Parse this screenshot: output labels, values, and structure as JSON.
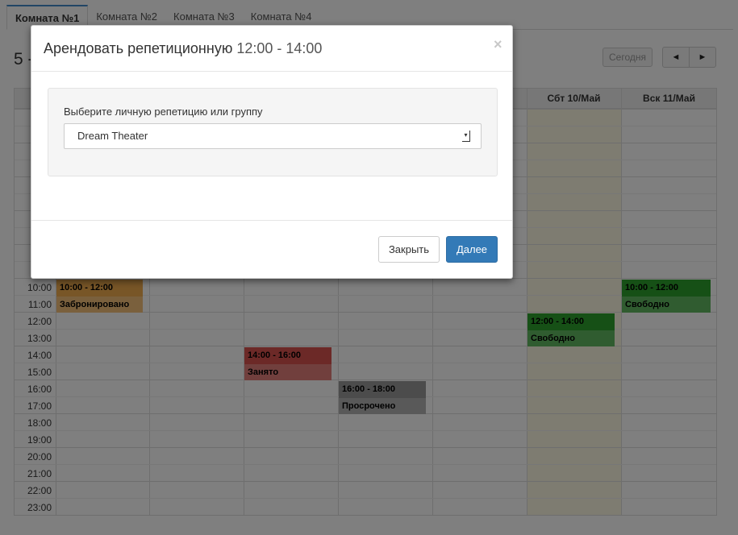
{
  "tabs": [
    {
      "label": "Комната №1",
      "active": true
    },
    {
      "label": "Комната №2",
      "active": false
    },
    {
      "label": "Комната №3",
      "active": false
    },
    {
      "label": "Комната №4",
      "active": false
    }
  ],
  "toolbar": {
    "range_title": "5 -",
    "today_label": "Сегодня",
    "prev_glyph": "◄",
    "next_glyph": "►"
  },
  "calendar": {
    "visible_headers": [
      "Сбт 10/Май",
      "Вск 11/Май"
    ],
    "time_labels": [
      "10:00",
      "11:00",
      "12:00",
      "13:00",
      "14:00",
      "15:00",
      "16:00",
      "17:00",
      "18:00",
      "19:00",
      "20:00",
      "21:00",
      "22:00",
      "23:00"
    ],
    "events": [
      {
        "time": "10:00 - 12:00",
        "title": "Забронировано",
        "color": "#f0ad4e",
        "day": 0,
        "start": 10,
        "end": 12
      },
      {
        "time": "14:00 - 16:00",
        "title": "Занято",
        "color": "#d9534f",
        "day": 2,
        "start": 14,
        "end": 16
      },
      {
        "time": "16:00 - 18:00",
        "title": "Просрочено",
        "color": "#999999",
        "day": 3,
        "start": 16,
        "end": 18
      },
      {
        "time": "12:00 - 14:00",
        "title": "Свободно",
        "color": "#2da02d",
        "day": 5,
        "start": 12,
        "end": 14
      },
      {
        "time": "10:00 - 12:00",
        "title": "Свободно",
        "color": "#2da02d",
        "day": 6,
        "start": 10,
        "end": 12
      }
    ],
    "today_column_color": "#fcf8e3"
  },
  "modal": {
    "title": "Арендовать репетиционную",
    "title_time": "12:00 - 14:00",
    "close_glyph": "×",
    "field_label": "Выберите личную репетицию или группу",
    "select_value": "Dream Theater",
    "close_button": "Закрыть",
    "next_button": "Далее",
    "primary_color": "#337ab7"
  }
}
